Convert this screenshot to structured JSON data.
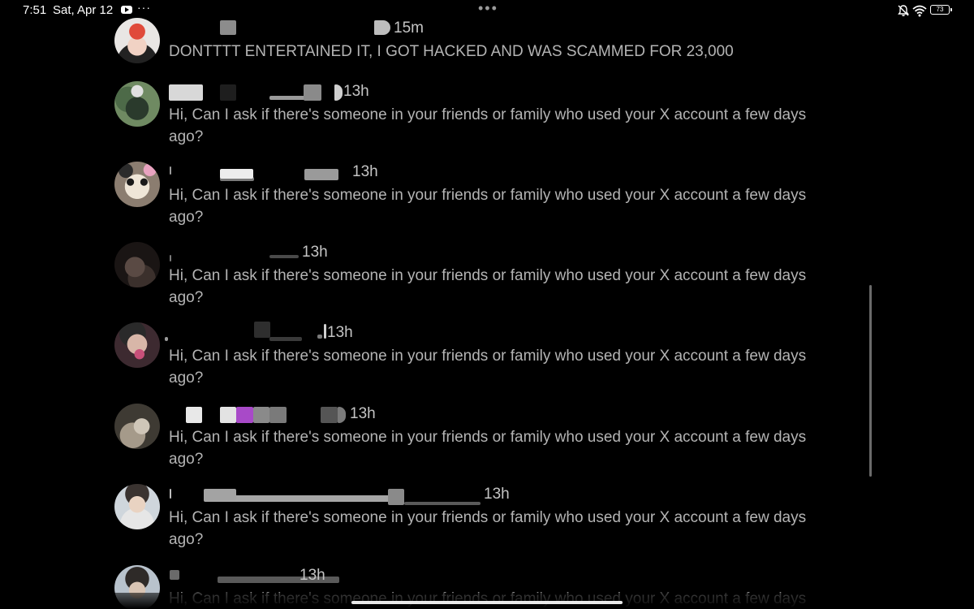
{
  "status_bar": {
    "time": "7:51",
    "date": "Sat, Apr 12",
    "more": "···",
    "center_menu": "•••",
    "battery": "73",
    "icons": [
      "youtube-icon",
      "silent-bell-icon",
      "wifi-icon",
      "battery-icon"
    ]
  },
  "messages": [
    {
      "time": "15m",
      "text": "DONTTTT ENTERTAINED IT, I GOT HACKED AND WAS SCAMMED FOR 23,000"
    },
    {
      "time": "13h",
      "text": "Hi, Can I ask if there's someone in your friends or family who used your X account a few days ago?"
    },
    {
      "time": "13h",
      "text": "Hi, Can I ask if there's someone in your friends or family who used your X account a few days ago?"
    },
    {
      "time": "13h",
      "text": "Hi, Can I ask if there's someone in your friends or family who used your X account a few days ago?"
    },
    {
      "time": "13h",
      "text": "Hi, Can I ask if there's someone in your friends or family who used your X account a few days ago?"
    },
    {
      "time": "13h",
      "text": "Hi, Can I ask if there's someone in your friends or family who used your X account a few days ago?"
    },
    {
      "time": "13h",
      "text": "Hi, Can I ask if there's someone in your friends or family who used your X account a few days ago?"
    },
    {
      "time": "13h",
      "text": "Hi, Can I ask if there's someone in your friends or family who used your X account a few days ago?"
    }
  ],
  "colors": {
    "background": "#000000",
    "message_text": "#b4b4b4",
    "timestamp": "#c4c4c4",
    "scrollbar": "#6a6a6a"
  }
}
